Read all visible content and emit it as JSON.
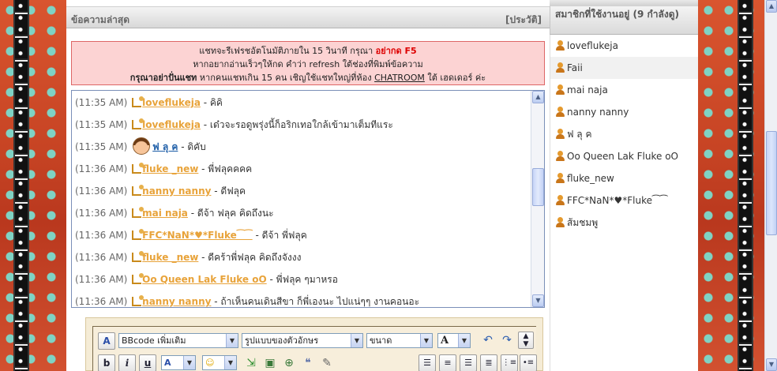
{
  "chat": {
    "header_title": "ข้อความล่าสุด",
    "history_link": "[ประวัติ]",
    "notice": {
      "line1_prefix": "แชทจะรีเฟรชอัตโนมัติภายใน 15 วินาที กรุณา ",
      "line1_highlight": "อย่ากด F5",
      "line2": "หากอยากอ่านเร็วๆให้กด คำว่า refresh ใต้ช่องที่พิมพ์ข้อความ",
      "line3_bold": "กรุณาอย่าปั่นแชท",
      "line3_mid": " หากคนแชทเกิน 15 คน เชิญใช้แชทใหญ่ที่ห้อง ",
      "line3_link": "CHATROOM",
      "line3_suffix": " ใต้ เฮดเดอร์ ค่ะ"
    },
    "messages": [
      {
        "time": "(11:35 AM)",
        "user": "loveflukeja",
        "text": " - คิคิ",
        "icon": "note-icon"
      },
      {
        "time": "(11:35 AM)",
        "user": "loveflukeja",
        "text": " - เด๋วจะรอดูพรุ่งนี้ก็อริกเทอใกล้เข้ามาเต็มทีแระ",
        "icon": "note-icon"
      },
      {
        "time": "(11:35 AM)",
        "user": "ฟ ลุ ค",
        "text": " - ดิคับ",
        "icon": "avatar-face-icon"
      },
      {
        "time": "(11:36 AM)",
        "user": "fluke _new",
        "text": " - พี่ฟลุคคคค",
        "icon": "note-icon"
      },
      {
        "time": "(11:36 AM)",
        "user": "nanny nanny",
        "text": " - ดีฟลุค",
        "icon": "note-icon"
      },
      {
        "time": "(11:36 AM)",
        "user": "mai naja",
        "text": " - ดีจ้า ฟลุค คิดถึงนะ",
        "icon": "note-icon"
      },
      {
        "time": "(11:36 AM)",
        "user": "FFC*NaN*♥*Fluke⁀⁀",
        "text": " - ดีจ้า พี่ฟลุค",
        "icon": "note-icon"
      },
      {
        "time": "(11:36 AM)",
        "user": "fluke _new",
        "text": " - ดีคร้าพี่ฟลุค คิดถึงจังงง",
        "icon": "note-icon"
      },
      {
        "time": "(11:36 AM)",
        "user": "Oo Queen Lak Fluke oO",
        "text": " - พี่ฟลุค ๆมาหรอ",
        "icon": "note-icon"
      },
      {
        "time": "(11:36 AM)",
        "user": "nanny nanny",
        "text": " - ถ้าเห็นคนเดินสีขา ก็พี่เองนะ ไปแน่ๆๆ งานคอนอะ",
        "icon": "note-icon"
      }
    ]
  },
  "members": {
    "header": "สมาชิกที่ใช้งานอยู่ (9 กำลังดู)",
    "list": [
      "loveflukeja",
      "Faii",
      "mai naja",
      "nanny nanny",
      "ฟ ลุ ค",
      "Oo Queen Lak Fluke oO",
      "fluke_new",
      "FFC*NaN*♥*Fluke⁀⁀",
      "ส้มชมพู"
    ]
  },
  "toolbar": {
    "bbcode_select": "BBcode เพิ่มเติม",
    "font_select": "รูปแบบของตัวอักษร",
    "size_select": "ขนาด",
    "bold": "b",
    "italic": "i",
    "underline": "u",
    "font_color": "A",
    "text_color": "A"
  },
  "colors": {
    "username": "#e8a33a",
    "username_alt": "#1f5fa8",
    "notice_bg": "#fcd3d3",
    "notice_red": "#dd0000",
    "toolbar_bg": "#f5ecd6"
  }
}
